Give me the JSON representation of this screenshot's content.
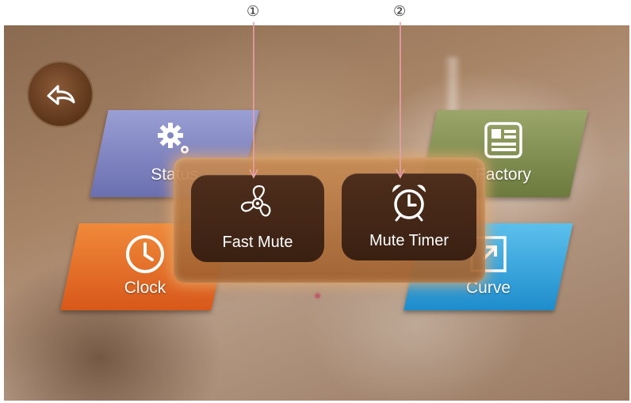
{
  "callouts": [
    "①",
    "②"
  ],
  "tiles": {
    "status": "Status",
    "clock": "Clock",
    "factory": "Factory",
    "curve": "Curve"
  },
  "popup": {
    "fast_mute": {
      "label": "Fast Mute",
      "icon": "fan-icon"
    },
    "mute_timer": {
      "label": "Mute Timer",
      "icon": "alarm-clock-icon"
    }
  },
  "icons": {
    "back": "back-arrow-icon"
  },
  "colors": {
    "status_tile": "#7a7fc0",
    "clock_tile": "#e46a28",
    "factory_tile": "#7f8c4e",
    "curve_tile": "#3aa6dc",
    "popup_frame": "#b4783c",
    "popup_button": "#432616",
    "callout_line": "#e8a0a8"
  }
}
